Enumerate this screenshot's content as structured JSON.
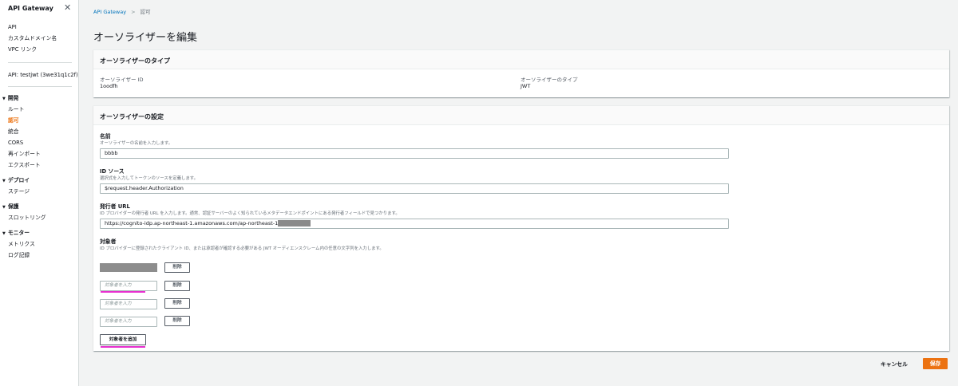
{
  "sidebar": {
    "title": "API Gateway",
    "top_links": [
      "API",
      "カスタムドメイン名",
      "VPC リンク"
    ],
    "api_label": "API: testjwt (3we31q1c2f)",
    "sections": [
      {
        "label": "開発",
        "items": [
          "ルート",
          "認可",
          "統合",
          "CORS",
          "再インポート",
          "エクスポート"
        ],
        "active": "認可"
      },
      {
        "label": "デプロイ",
        "items": [
          "ステージ"
        ]
      },
      {
        "label": "保護",
        "items": [
          "スロットリング"
        ]
      },
      {
        "label": "モニター",
        "items": [
          "メトリクス",
          "ログ記録"
        ]
      }
    ]
  },
  "breadcrumb": {
    "root": "API Gateway",
    "current": "認可"
  },
  "page_title": "オーソライザーを編集",
  "type_panel": {
    "heading": "オーソライザーのタイプ",
    "id_label": "オーソライザー ID",
    "id_value": "1oodfh",
    "type_label": "オーソライザーのタイプ",
    "type_value": "JWT"
  },
  "config_panel": {
    "heading": "オーソライザーの設定",
    "name_label": "名前",
    "name_desc": "オーソライザーの名前を入力します。",
    "name_value": "bbbb",
    "source_label": "ID ソース",
    "source_desc": "選択式を入力してトークンのソースを定義します。",
    "source_value": "$request.header.Authorization",
    "issuer_label": "発行者 URL",
    "issuer_desc": "ID プロバイダーの発行者 URL を入力します。通常、認証サーバーのよく知られているメタデータエンドポイントにある発行者フィールドで見つかります。",
    "issuer_value": "https://cognito-idp.ap-northeast-1.amazonaws.com/ap-northeast-1",
    "audience_label": "対象者",
    "audience_desc": "ID プロバイダーに登録されたクライアント ID、または承認者が確認する必要がある JWT オーディエンスクレーム内の任意の文字列を入力します。",
    "audience_placeholder": "対象者を入力",
    "remove_label": "削除",
    "add_label": "対象者を追加"
  },
  "footer": {
    "cancel": "キャンセル",
    "save": "保存"
  },
  "colors": {
    "accent": "#ec7211",
    "link": "#0073bb",
    "highlight": "#e631cf"
  }
}
